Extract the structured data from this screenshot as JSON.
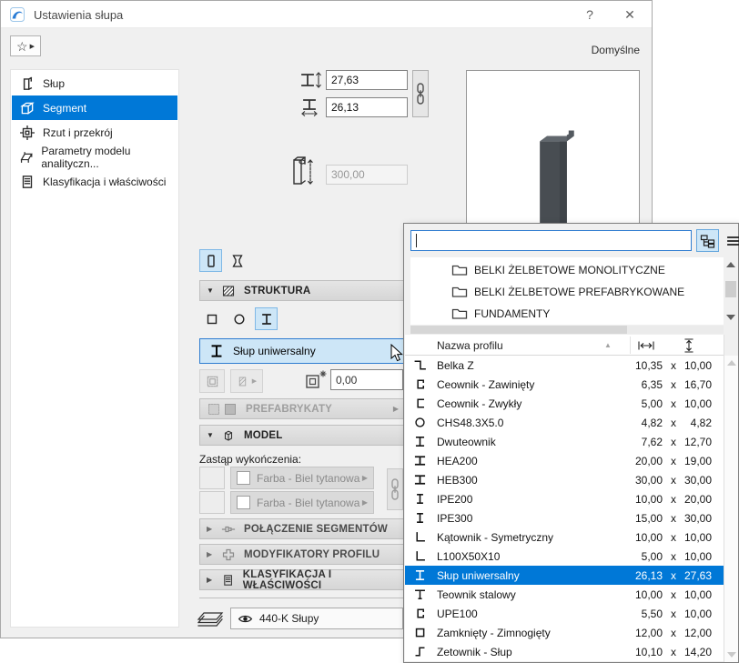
{
  "colors": {
    "accent": "#0078d7",
    "toggle_bg": "#cde6f7",
    "header_bg": "#dcdcdc",
    "selection": "#0078d7"
  },
  "window": {
    "title": "Ustawienia słupa",
    "help_label": "?",
    "close_label": "✕"
  },
  "toolbar": {
    "favorites_icon": "star-icon",
    "defaults_label": "Domyślne"
  },
  "sidebar": {
    "items": [
      {
        "label": "Słup",
        "icon": "column",
        "selected": false
      },
      {
        "label": "Segment",
        "icon": "cube",
        "selected": true
      },
      {
        "label": "Rzut i przekrój",
        "icon": "plan-section",
        "selected": false
      },
      {
        "label": "Parametry modelu analityczn...",
        "icon": "analytical",
        "selected": false
      },
      {
        "label": "Klasyfikacja i właściwości",
        "icon": "doc-lines",
        "selected": false
      }
    ]
  },
  "dimensions": {
    "profile_height": "27,63",
    "profile_width": "26,13",
    "column_height": "300,00"
  },
  "structure": {
    "title": "STRUKTURA",
    "profile_name": "Słup uniwersalny",
    "offset_value": "0,00"
  },
  "prefab": {
    "title": "PREFABRYKATY"
  },
  "model": {
    "title": "MODEL",
    "override_label": "Zastąp wykończenia:",
    "finish_top": "Farba - Biel tytanowa",
    "finish_side": "Farba - Biel tytanowa"
  },
  "collapsed_sections": {
    "segments": "POŁĄCZENIE SEGMENTÓW",
    "modifiers": "MODYFIKATORY PROFILU",
    "classification": "KLASYFIKACJA I WŁAŚCIWOŚCI"
  },
  "layer": {
    "value": "440-K Słupy"
  },
  "popup": {
    "search_value": "",
    "folders": [
      {
        "label": "BELKI ŻELBETOWE MONOLITYCZNE"
      },
      {
        "label": "BELKI ŻELBETOWE PREFABRYKOWANE"
      },
      {
        "label": "FUNDAMENTY"
      },
      {
        "label": ""
      }
    ],
    "table": {
      "name_header": "Nazwa profilu",
      "sep": "x",
      "rows": [
        {
          "name": "Belka Z",
          "w": "10,35",
          "h": "10,00",
          "icon": "z-beam",
          "selected": false
        },
        {
          "name": "Ceownik - Zawinięty",
          "w": "6,35",
          "h": "16,70",
          "icon": "c-lipped",
          "selected": false
        },
        {
          "name": "Ceownik - Zwykły",
          "w": "5,00",
          "h": "10,00",
          "icon": "c-plain",
          "selected": false
        },
        {
          "name": "CHS48.3X5.0",
          "w": "4,82",
          "h": "4,82",
          "icon": "circle",
          "selected": false
        },
        {
          "name": "Dwuteownik",
          "w": "7,62",
          "h": "12,70",
          "icon": "i-serif",
          "selected": false
        },
        {
          "name": "HEA200",
          "w": "20,00",
          "h": "19,00",
          "icon": "i-wide",
          "selected": false
        },
        {
          "name": "HEB300",
          "w": "30,00",
          "h": "30,00",
          "icon": "i-wide",
          "selected": false
        },
        {
          "name": "IPE200",
          "w": "10,00",
          "h": "20,00",
          "icon": "i-narrow",
          "selected": false
        },
        {
          "name": "IPE300",
          "w": "15,00",
          "h": "30,00",
          "icon": "i-narrow",
          "selected": false
        },
        {
          "name": "Kątownik - Symetryczny",
          "w": "10,00",
          "h": "10,00",
          "icon": "l-angle",
          "selected": false
        },
        {
          "name": "L100X50X10",
          "w": "5,00",
          "h": "10,00",
          "icon": "l-angle",
          "selected": false
        },
        {
          "name": "Słup uniwersalny",
          "w": "26,13",
          "h": "27,63",
          "icon": "i-serif",
          "selected": true
        },
        {
          "name": "Teownik stalowy",
          "w": "10,00",
          "h": "10,00",
          "icon": "t-steel",
          "selected": false
        },
        {
          "name": "UPE100",
          "w": "5,50",
          "h": "10,00",
          "icon": "c-lipped",
          "selected": false
        },
        {
          "name": "Zamknięty - Zimnogięty",
          "w": "12,00",
          "h": "12,00",
          "icon": "square",
          "selected": false
        },
        {
          "name": "Zetownik - Słup",
          "w": "10,10",
          "h": "14,20",
          "icon": "s-zet",
          "selected": false
        }
      ]
    }
  }
}
